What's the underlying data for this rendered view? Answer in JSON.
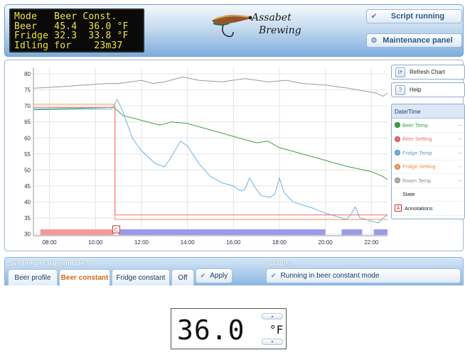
{
  "lcd": {
    "lines": [
      "Mode   Beer Const.",
      "Beer   45.4  36.0 °F",
      "Fridge 32.3  33.8 °F",
      "Idling for    23m37"
    ]
  },
  "logo": {
    "line1": "Assabet",
    "line2": "Brewing"
  },
  "header_buttons": {
    "script_running": "Script running",
    "maintenance": "Maintenance panel"
  },
  "chart_buttons": {
    "refresh": "Refresh Chart",
    "help": "Help",
    "help_glyph": "?"
  },
  "legend": {
    "header": "Date/Time",
    "items": [
      {
        "label": "Beer Temp",
        "value": "--",
        "color": "#3aa34a"
      },
      {
        "label": "Beer Setting",
        "value": "--",
        "color": "#ee6b6b"
      },
      {
        "label": "Fridge Temp",
        "value": "--",
        "color": "#6ab4e8"
      },
      {
        "label": "Fridge Setting",
        "value": "--",
        "color": "#f0a060"
      },
      {
        "label": "Room Temp",
        "value": "--",
        "color": "#9a9a9a"
      },
      {
        "label": "State",
        "value": ""
      },
      {
        "label": "Annotations",
        "value": "",
        "glyph": "A"
      }
    ]
  },
  "chart_data": {
    "type": "line",
    "xlabel": "",
    "ylabel": "",
    "yticks": [
      30,
      35,
      40,
      45,
      50,
      55,
      60,
      65,
      70,
      75,
      80
    ],
    "ylim": [
      29.5,
      82
    ],
    "xticks": [
      "08:00",
      "10:00",
      "12:00",
      "14:00",
      "16:00",
      "18:00",
      "20:00",
      "22:00"
    ],
    "xlim_hours": [
      7.3,
      22.7
    ],
    "grid": true,
    "annotation": {
      "x": 10.9,
      "label": "C"
    },
    "series": [
      {
        "name": "Room Temp",
        "color": "#9a9a9a",
        "points": [
          [
            7.3,
            75.5
          ],
          [
            8.5,
            76
          ],
          [
            9.5,
            76.5
          ],
          [
            10.5,
            77
          ],
          [
            11,
            77
          ],
          [
            12,
            78
          ],
          [
            12.5,
            77
          ],
          [
            13,
            77.5
          ],
          [
            13.8,
            79
          ],
          [
            14.5,
            78
          ],
          [
            15.5,
            77.5
          ],
          [
            16.5,
            78.5
          ],
          [
            17.5,
            77.5
          ],
          [
            18.3,
            78
          ],
          [
            19,
            77
          ],
          [
            20,
            76.5
          ],
          [
            20.5,
            76
          ],
          [
            21,
            75.5
          ],
          [
            21.8,
            74.5
          ],
          [
            22.2,
            74
          ],
          [
            22.5,
            73
          ],
          [
            22.7,
            74
          ]
        ]
      },
      {
        "name": "Beer Temp",
        "color": "#3aa34a",
        "points": [
          [
            7.3,
            69
          ],
          [
            9,
            69.2
          ],
          [
            10.8,
            69.5
          ],
          [
            11.2,
            67
          ],
          [
            12,
            65.5
          ],
          [
            12.8,
            64
          ],
          [
            13.3,
            65
          ],
          [
            14,
            64.5
          ],
          [
            15,
            62.5
          ],
          [
            16,
            60.5
          ],
          [
            17,
            58.5
          ],
          [
            17.5,
            59
          ],
          [
            18,
            57
          ],
          [
            19,
            55
          ],
          [
            20,
            53
          ],
          [
            21,
            51
          ],
          [
            22,
            49.5
          ],
          [
            22.5,
            48
          ],
          [
            22.7,
            47
          ]
        ]
      },
      {
        "name": "Fridge Temp",
        "color": "#6ab4e8",
        "points": [
          [
            7.3,
            68.8
          ],
          [
            10.7,
            69
          ],
          [
            10.95,
            72
          ],
          [
            11.2,
            68
          ],
          [
            11.6,
            60
          ],
          [
            12,
            56
          ],
          [
            12.6,
            52
          ],
          [
            13,
            51
          ],
          [
            13.2,
            53
          ],
          [
            13.7,
            59
          ],
          [
            14,
            57.5
          ],
          [
            14.5,
            52
          ],
          [
            15,
            48
          ],
          [
            15.5,
            46
          ],
          [
            16,
            45
          ],
          [
            16.3,
            43.5
          ],
          [
            16.5,
            44
          ],
          [
            16.7,
            47.5
          ],
          [
            16.9,
            45
          ],
          [
            17.2,
            42
          ],
          [
            17.6,
            41.5
          ],
          [
            17.8,
            42.5
          ],
          [
            18,
            47.5
          ],
          [
            18.2,
            43
          ],
          [
            18.6,
            40
          ],
          [
            19.5,
            38
          ],
          [
            20,
            36.5
          ],
          [
            20.5,
            35.5
          ],
          [
            20.9,
            34.5
          ],
          [
            21.1,
            36
          ],
          [
            21.3,
            38.5
          ],
          [
            21.5,
            35
          ],
          [
            21.8,
            34.5
          ],
          [
            22,
            34
          ],
          [
            22.3,
            33.5
          ],
          [
            22.5,
            35
          ],
          [
            22.7,
            36
          ]
        ]
      },
      {
        "name": "Fridge Setting",
        "color": "#f0a060",
        "points": [
          [
            7.3,
            70.5
          ],
          [
            10.8,
            70.5
          ],
          [
            10.85,
            70.5
          ],
          [
            10.85,
            34.5
          ],
          [
            22.7,
            34.5
          ]
        ]
      },
      {
        "name": "Beer Setting",
        "color": "#ee6b6b",
        "points": [
          [
            7.3,
            69.5
          ],
          [
            10.85,
            69.5
          ],
          [
            10.85,
            36
          ],
          [
            22.7,
            36
          ]
        ]
      }
    ],
    "state_segments": [
      {
        "from": 7.6,
        "to": 10.8,
        "color": "#f39a9a"
      },
      {
        "from": 11.0,
        "to": 20.0,
        "color": "#9b9bea"
      },
      {
        "from": 20.7,
        "to": 21.6,
        "color": "#9b9bea"
      },
      {
        "from": 22.1,
        "to": 22.7,
        "color": "#9b9bea"
      }
    ]
  },
  "panel": {
    "mode_title": "Set temperature mode:",
    "status_title": "Status:",
    "tabs": [
      "Beer profile",
      "Beer constant",
      "Fridge constant",
      "Off"
    ],
    "active_tab": "Beer constant",
    "apply": "Apply",
    "status": "Running in beer constant mode"
  },
  "setpoint": {
    "value": "36.0",
    "unit": "°F"
  }
}
